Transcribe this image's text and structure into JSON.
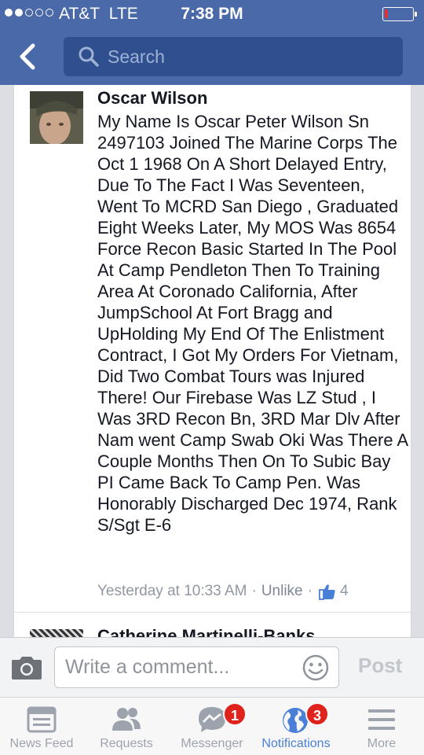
{
  "status_bar": {
    "carrier": "AT&T",
    "network": "LTE",
    "time": "7:38 PM",
    "battery_level": 0.12
  },
  "nav": {
    "search_placeholder": "Search"
  },
  "post": {
    "author": "Oscar Wilson",
    "text": "My Name Is Oscar Peter Wilson Sn 2497103 Joined The  Marine Corps The Oct 1 1968 On A Short Delayed Entry, Due To The Fact I Was Seventeen, Went To MCRD San Diego , Graduated Eight Weeks Later, My MOS Was 8654 Force Recon Basic Started In The Pool At Camp Pendleton Then To Training Area At Coronado California, After JumpSchool At Fort Bragg and UpHolding My End Of The Enlistment Contract, I Got My Orders For Vietnam, Did Two Combat Tours was Injured There! Our Firebase Was LZ Stud , I Was 3RD Recon Bn, 3RD Mar Dlv  After Nam went Camp Swab Oki Was There A Couple Months Then On To Subic Bay PI  Came Back To Camp Pen. Was Honorably Discharged Dec 1974, Rank S/Sgt E-6",
    "timestamp": "Yesterday at 10:33 AM",
    "separator": "·",
    "unlike_label": "Unlike",
    "like_count": "4"
  },
  "next_post": {
    "author": "Catherine Martinelli-Banks"
  },
  "comment_bar": {
    "placeholder": "Write a comment...",
    "post_label": "Post"
  },
  "tabs": [
    {
      "label": "News Feed",
      "icon": "news-feed-icon"
    },
    {
      "label": "Requests",
      "icon": "friend-requests-icon"
    },
    {
      "label": "Messenger",
      "icon": "messenger-icon",
      "badge": "1"
    },
    {
      "label": "Notifications",
      "icon": "globe-icon",
      "badge": "3",
      "active": true
    },
    {
      "label": "More",
      "icon": "menu-icon"
    }
  ],
  "colors": {
    "brand_blue": "#4a69a9",
    "active_tab": "#4a7fd8",
    "badge_red": "#e0221c"
  }
}
